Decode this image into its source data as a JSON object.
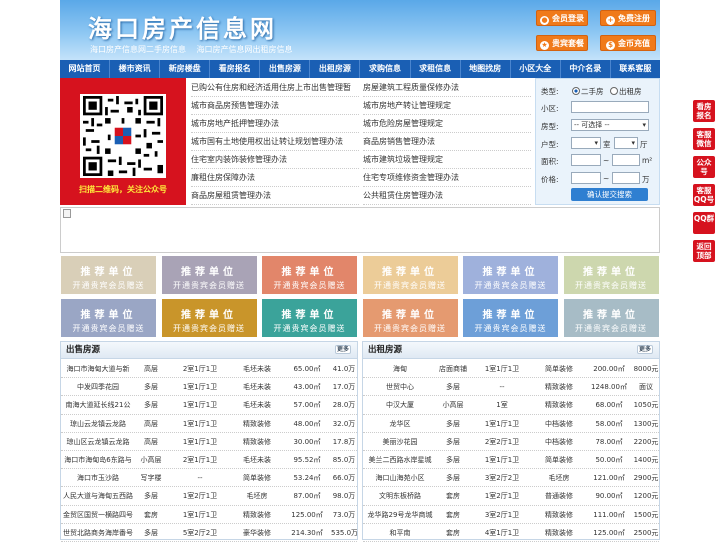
{
  "header": {
    "title": "海口房产信息网",
    "subtitle1": "海口房产信息网二手房信息",
    "subtitle2": "海口房产信息网出租房信息",
    "btn_login": "会员登录",
    "btn_register": "免费注册",
    "btn_package": "贵宾套餐",
    "btn_recharge": "金币充值"
  },
  "nav": [
    "网站首页",
    "楼市资讯",
    "新房楼盘",
    "看房报名",
    "出售房源",
    "出租房源",
    "求购信息",
    "求租信息",
    "地图找房",
    "小区大全",
    "中介名录",
    "联系客服"
  ],
  "qr": {
    "caption": "扫描二维码，关注公众号"
  },
  "links": {
    "left": [
      "已购公有住房和经济适用住房上市出售管理暂",
      "城市商品房预售管理办法",
      "城市房地产抵押管理办法",
      "城市国有土地使用权出让转让规划管理办法",
      "住宅室内装饰装修管理办法",
      "廉租住房保障办法",
      "商品房屋租赁管理办法"
    ],
    "right": [
      "房屋建筑工程质量保修办法",
      "城市房地产转让管理规定",
      "城市危险房屋管理规定",
      "商品房销售管理办法",
      "城市建筑垃圾管理规定",
      "住宅专项维修资金管理办法",
      "公共租赁住房管理办法"
    ]
  },
  "search": {
    "type_label": "类型:",
    "opt_sale": "二手房",
    "opt_rent": "出租房",
    "community_label": "小区:",
    "room_label": "房型:",
    "room_value": "-- 可选择 --",
    "layout_label": "户型:",
    "room_unit": "室",
    "hall_unit": "厅",
    "area_label": "面积:",
    "price_label": "价格:",
    "tilde": "~",
    "area_unit": "m²",
    "price_unit": "万",
    "submit": "确认提交搜索"
  },
  "ads": {
    "line1": "推荐单位",
    "line2": "开通贵宾会员赠送",
    "colors": [
      "#d9cfb8",
      "#a9a3b6",
      "#e2866a",
      "#eccc98",
      "#9fb1dc",
      "#cdd7ae",
      "#9aa6c5",
      "#c9952a",
      "#3ba39a",
      "#e59a70",
      "#6d9fd8",
      "#a7bcc6"
    ]
  },
  "sale": {
    "title": "出售房源",
    "more": "更多",
    "rows": [
      [
        "海口市海甸大道与新",
        "高层",
        "2室1厅1卫",
        "毛坯未装",
        "65.00㎡",
        "41.0万"
      ],
      [
        "中发四季花园",
        "多层",
        "1室1厅1卫",
        "毛坯未装",
        "43.00㎡",
        "17.0万"
      ],
      [
        "南海大道延长线21公",
        "多层",
        "1室1厅1卫",
        "毛坯未装",
        "57.00㎡",
        "28.0万"
      ],
      [
        "琼山云龙镇云龙路",
        "高层",
        "1室1厅1卫",
        "精致装修",
        "48.00㎡",
        "32.0万"
      ],
      [
        "琼山区云龙镇云龙路",
        "高层",
        "1室1厅1卫",
        "精致装修",
        "30.00㎡",
        "17.8万"
      ],
      [
        "海口市海甸岛6东路与",
        "小高层",
        "2室1厅1卫",
        "毛坯未装",
        "95.52㎡",
        "85.0万"
      ],
      [
        "海口市玉沙路",
        "写字楼",
        "--",
        "简单装修",
        "53.24㎡",
        "66.0万"
      ],
      [
        "人民大道与海甸五西路",
        "多层",
        "1室2厅1卫",
        "毛坯房",
        "87.00㎡",
        "98.0万"
      ],
      [
        "金贸区国贸一横路四号",
        "套房",
        "1室1厅1卫",
        "精致装修",
        "125.00㎡",
        "73.0万"
      ],
      [
        "世贸北路商务海岸番号",
        "多层",
        "5室2厅2卫",
        "豪华装修",
        "214.30㎡",
        "535.0万"
      ]
    ]
  },
  "rent": {
    "title": "出租房源",
    "more": "更多",
    "rows": [
      [
        "海甸",
        "店面商铺",
        "1室1厅1卫",
        "简单装修",
        "200.00㎡",
        "8000元"
      ],
      [
        "世贸中心",
        "多层",
        "--",
        "精致装修",
        "1248.00㎡",
        "面议"
      ],
      [
        "中汉大厦",
        "小高层",
        "1室",
        "精致装修",
        "68.00㎡",
        "1050元"
      ],
      [
        "龙华区",
        "多层",
        "1室1厅1卫",
        "中档装修",
        "58.00㎡",
        "1300元"
      ],
      [
        "美丽沙花园",
        "多层",
        "2室2厅1卫",
        "中档装修",
        "78.00㎡",
        "2200元"
      ],
      [
        "美兰二西路水岸星城",
        "多层",
        "1室1厅1卫",
        "简单装修",
        "50.00㎡",
        "1400元"
      ],
      [
        "海口山海苑小区",
        "多层",
        "3室2厅2卫",
        "毛坯房",
        "121.00㎡",
        "2900元"
      ],
      [
        "文明东板桥路",
        "套房",
        "1室2厅1卫",
        "普通装修",
        "90.00㎡",
        "1200元"
      ],
      [
        "龙华路29号龙华商城",
        "套房",
        "3室2厅1卫",
        "精致装修",
        "111.00㎡",
        "1500元"
      ],
      [
        "和平南",
        "套房",
        "4室1厅1卫",
        "精致装修",
        "125.00㎡",
        "2500元"
      ]
    ]
  },
  "float": [
    "看房报名",
    "客服微信",
    "公众号",
    "客服QQ号",
    "QQ群",
    "返回顶部"
  ]
}
